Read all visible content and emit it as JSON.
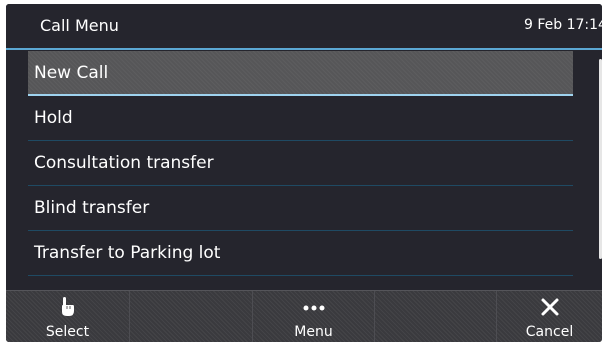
{
  "header": {
    "title": "Call Menu",
    "datetime": "9 Feb 17:14"
  },
  "menu": {
    "items": [
      {
        "label": "New Call",
        "selected": true
      },
      {
        "label": "Hold"
      },
      {
        "label": "Consultation transfer"
      },
      {
        "label": "Blind transfer"
      },
      {
        "label": "Transfer to Parking lot"
      }
    ]
  },
  "softkeys": {
    "select": {
      "label": "Select",
      "icon": "hand-pointer-icon"
    },
    "menu": {
      "label": "Menu",
      "icon": "more-dots-icon"
    },
    "cancel": {
      "label": "Cancel",
      "icon": "close-icon"
    }
  },
  "colors": {
    "background": "#25252d",
    "accent": "#5ba7d3",
    "selected_row": "#565658",
    "softkey_bar": "#3a3a3e"
  }
}
